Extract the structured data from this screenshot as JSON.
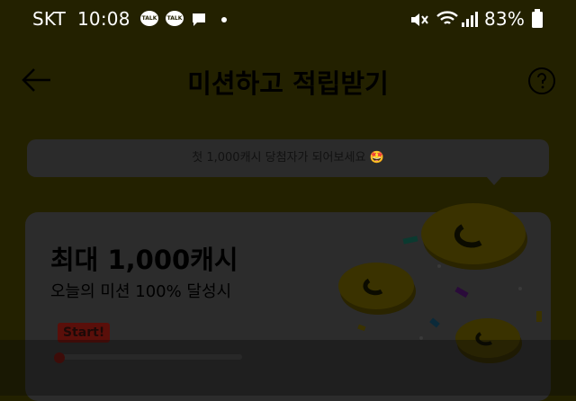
{
  "status_bar": {
    "carrier": "SKT",
    "time": "10:08",
    "notifications": [
      "TALK",
      "TALK"
    ],
    "battery": "83%",
    "icons": [
      "mute-icon",
      "wifi-icon",
      "signal-icon",
      "battery-icon",
      "message-icon"
    ]
  },
  "header": {
    "title": "미션하고 적립받기",
    "back_icon": "arrow-left-icon",
    "help_icon": "question-icon"
  },
  "banner": {
    "text": "첫 1,000캐시 당첨자가 되어보세요 🤩"
  },
  "mission_card": {
    "headline": "최대 1,000캐시",
    "subline": "오늘의 미션 100% 달성시",
    "start_label": "Start!",
    "progress": 0
  },
  "colors": {
    "background": "#232100",
    "card": "#2c2c2c",
    "start_badge": "#5a0f0a"
  }
}
